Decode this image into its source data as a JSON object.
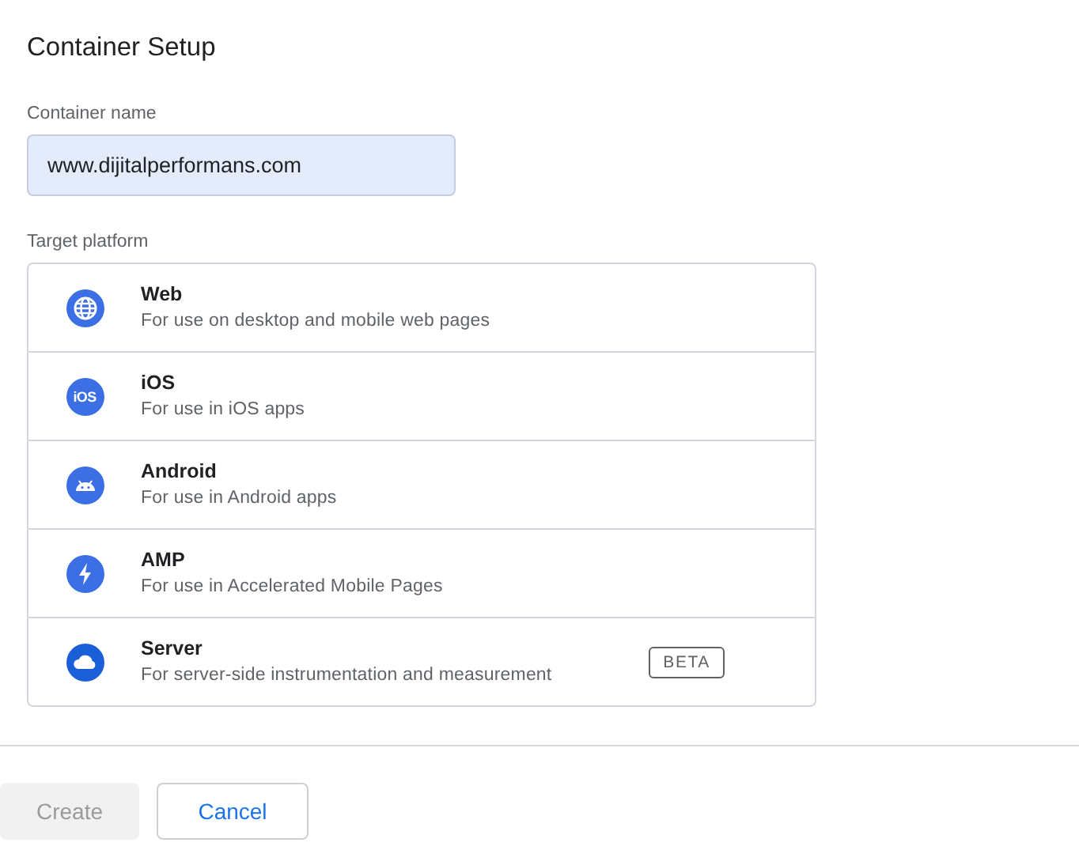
{
  "dialog": {
    "title": "Container Setup"
  },
  "container_name": {
    "label": "Container name",
    "value": "www.dijitalperformans.com"
  },
  "target_platform": {
    "label": "Target platform",
    "options": [
      {
        "kind": "web",
        "name": "Web",
        "description": "For use on desktop and mobile web pages"
      },
      {
        "kind": "ios",
        "name": "iOS",
        "description": "For use in iOS apps",
        "icon_text": "iOS"
      },
      {
        "kind": "android",
        "name": "Android",
        "description": "For use in Android apps"
      },
      {
        "kind": "amp",
        "name": "AMP",
        "description": "For use in Accelerated Mobile Pages"
      },
      {
        "kind": "server",
        "name": "Server",
        "description": "For server-side instrumentation and measurement",
        "badge": "BETA"
      }
    ]
  },
  "buttons": [
    {
      "label": "Create",
      "kind": "primary",
      "disabled": true
    },
    {
      "label": "Cancel",
      "kind": "secondary",
      "disabled": false
    }
  ]
}
